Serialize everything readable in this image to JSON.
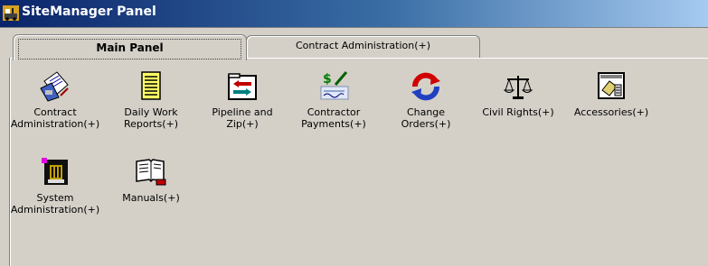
{
  "window": {
    "title": "SiteManager Panel",
    "icon": "sitemanager-app-icon"
  },
  "tabs": [
    {
      "label": "Main Panel",
      "selected": true
    },
    {
      "label": "Contract Administration(+)",
      "selected": false
    }
  ],
  "items": [
    {
      "label": "Contract\nAdministration(+)",
      "icon": "contract-document-icon"
    },
    {
      "label": "Daily Work\nReports(+)",
      "icon": "notepad-icon"
    },
    {
      "label": "Pipeline and\nZip(+)",
      "icon": "folder-arrows-icon"
    },
    {
      "label": "Contractor\nPayments(+)",
      "icon": "check-payment-icon"
    },
    {
      "label": "Change\nOrders(+)",
      "icon": "refresh-arrows-icon"
    },
    {
      "label": "Civil Rights(+)",
      "icon": "scales-icon"
    },
    {
      "label": "Accessories(+)",
      "icon": "accessories-icon"
    },
    {
      "label": "System\nAdministration(+)",
      "icon": "system-admin-icon"
    },
    {
      "label": "Manuals(+)",
      "icon": "manual-book-icon"
    }
  ],
  "colors": {
    "titlebar_start": "#0a246a",
    "titlebar_end": "#a6caf0",
    "face": "#d4d0c8"
  }
}
